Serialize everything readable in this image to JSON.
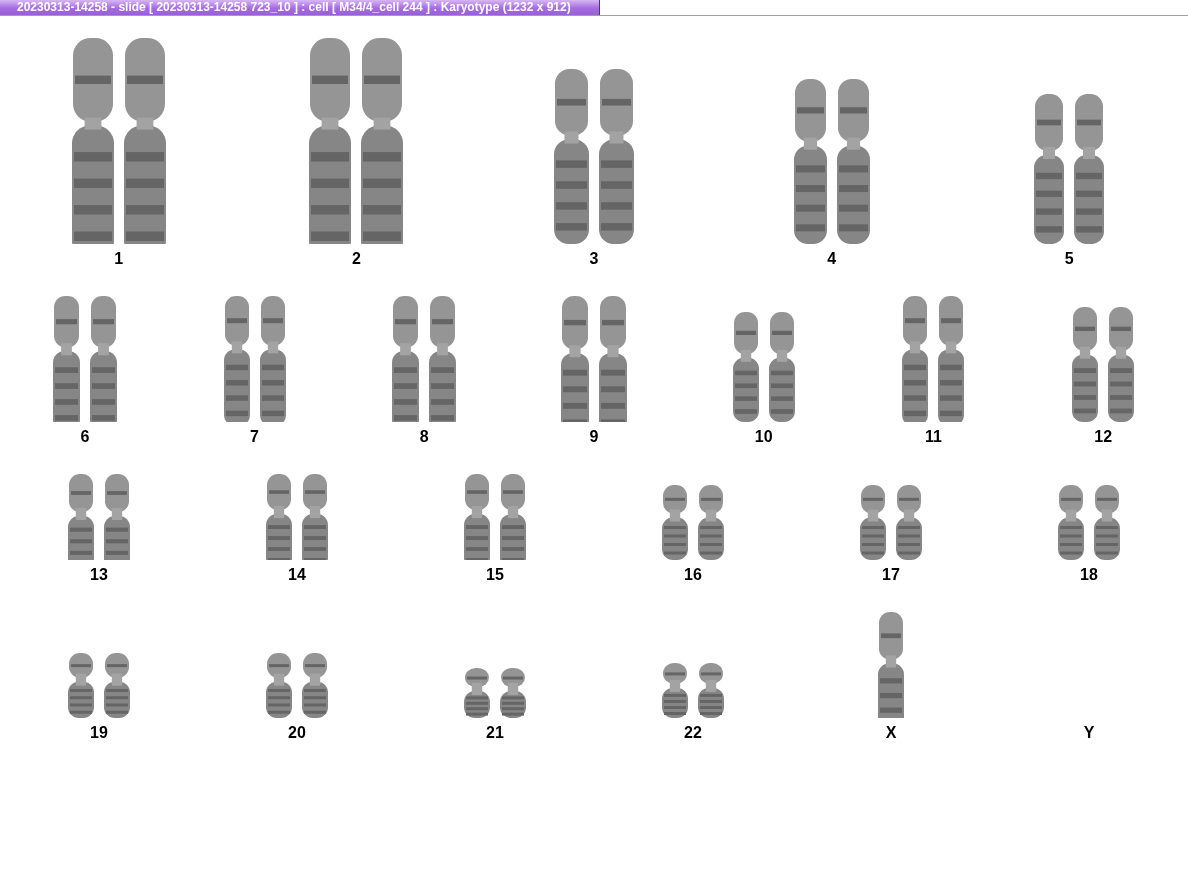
{
  "window": {
    "title": "20230313-14258 - slide [ 20230313-14258 723_10 ] : cell [ M34/4_cell 244 ] : Karyotype  (1232 x 912)"
  },
  "karyotype": {
    "rows": [
      {
        "chromosomes": [
          {
            "label": "1",
            "kind": "pair"
          },
          {
            "label": "2",
            "kind": "pair"
          },
          {
            "label": "3",
            "kind": "pair"
          },
          {
            "label": "4",
            "kind": "pair"
          },
          {
            "label": "5",
            "kind": "pair"
          }
        ]
      },
      {
        "chromosomes": [
          {
            "label": "6",
            "kind": "pair"
          },
          {
            "label": "7",
            "kind": "pair"
          },
          {
            "label": "8",
            "kind": "pair"
          },
          {
            "label": "9",
            "kind": "pair"
          },
          {
            "label": "10",
            "kind": "pair"
          },
          {
            "label": "11",
            "kind": "pair"
          },
          {
            "label": "12",
            "kind": "pair"
          }
        ]
      },
      {
        "chromosomes": [
          {
            "label": "13",
            "kind": "pair"
          },
          {
            "label": "14",
            "kind": "pair"
          },
          {
            "label": "15",
            "kind": "pair"
          },
          {
            "label": "16",
            "kind": "pair"
          },
          {
            "label": "17",
            "kind": "pair"
          },
          {
            "label": "18",
            "kind": "pair"
          }
        ]
      },
      {
        "chromosomes": [
          {
            "label": "19",
            "kind": "pair"
          },
          {
            "label": "20",
            "kind": "pair"
          },
          {
            "label": "21",
            "kind": "pair"
          },
          {
            "label": "22",
            "kind": "pair"
          },
          {
            "label": "X",
            "kind": "single"
          },
          {
            "label": "Y",
            "kind": "empty"
          }
        ]
      }
    ]
  }
}
